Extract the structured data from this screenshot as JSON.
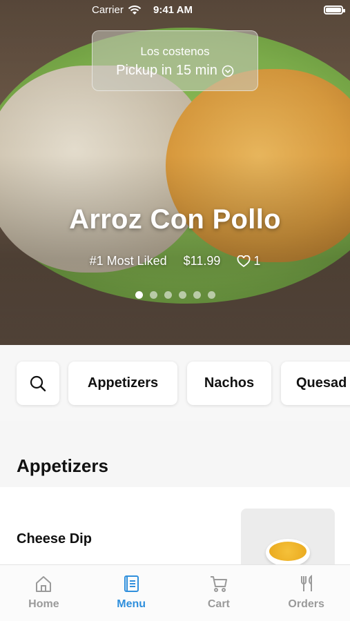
{
  "status_bar": {
    "carrier": "Carrier",
    "time": "9:41 AM"
  },
  "pickup": {
    "restaurant": "Los costenos",
    "eta": "Pickup in 15 min"
  },
  "featured": {
    "title": "Arroz Con Pollo",
    "rank": "#1 Most Liked",
    "price": "$11.99",
    "likes": "1",
    "carousel_count": 6,
    "carousel_active": 0
  },
  "categories": [
    "Appetizers",
    "Nachos",
    "Quesad"
  ],
  "section": {
    "title": "Appetizers"
  },
  "items": [
    {
      "name": "Cheese Dip"
    }
  ],
  "tabs": [
    {
      "label": "Home",
      "icon": "home-icon",
      "active": false
    },
    {
      "label": "Menu",
      "icon": "menu-book-icon",
      "active": true
    },
    {
      "label": "Cart",
      "icon": "cart-icon",
      "active": false
    },
    {
      "label": "Orders",
      "icon": "fork-knife-icon",
      "active": false
    }
  ],
  "colors": {
    "accent": "#2f8fdc",
    "inactive": "#9a9a9a"
  }
}
